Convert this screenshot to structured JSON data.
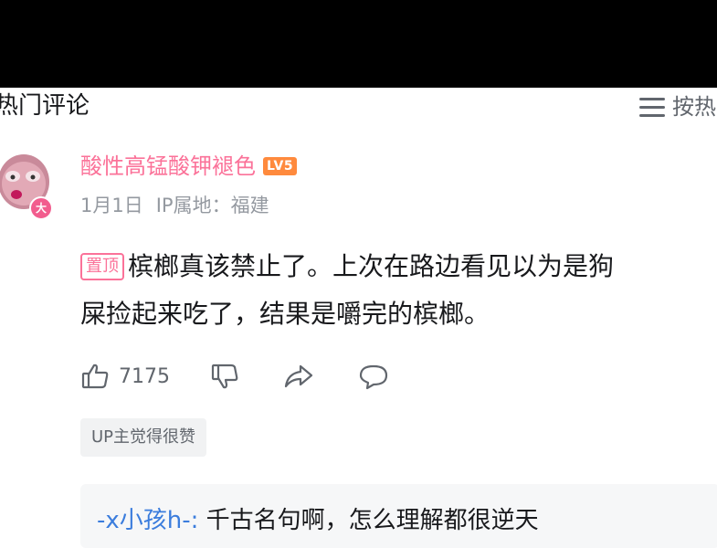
{
  "header": {
    "section_title": "热门评论",
    "sort_label": "按热"
  },
  "comment": {
    "username": "酸性高锰酸钾褪色",
    "level": "LV5",
    "avatar_badge": "大",
    "date": "1月1日",
    "ip_location": "IP属地：福建",
    "pin_label": "置顶",
    "text_line1": "槟榔真该禁止了。上次在路边看见以为是狗",
    "text_line2": "屎捡起来吃了，结果是嚼完的槟榔。",
    "like_count": "7175",
    "up_tag": "UP主觉得很赞"
  },
  "reply": {
    "username": "-x小孩h-:",
    "text": " 千古名句啊，怎么理解都很逆天"
  },
  "colors": {
    "accent_pink": "#fb7299",
    "level_orange": "#ff8a3d",
    "reply_user_blue": "#3b7ddd",
    "muted_gray": "#9499a0"
  }
}
